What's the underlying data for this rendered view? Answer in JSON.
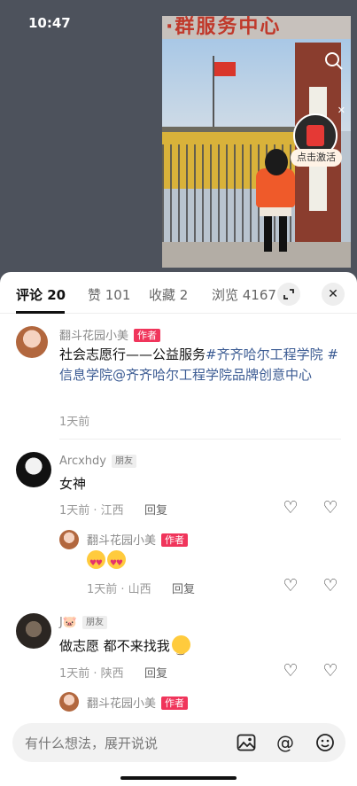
{
  "status": {
    "time": "10:47"
  },
  "video": {
    "banner_text": "·群服务中心",
    "activate_label": "点击激活"
  },
  "tabs": [
    {
      "label": "评论 20"
    },
    {
      "label": "赞 101"
    },
    {
      "label": "收藏 2"
    },
    {
      "label": "浏览 4167"
    }
  ],
  "comments": [
    {
      "user": "翻斗花园小美",
      "badge": "作者",
      "text_plain": "社会志愿行——公益服务",
      "tag1": "#齐齐哈尔工程学院",
      "tag2": "#信息学院",
      "mention": "@齐齐哈尔工程学院品牌创意中心",
      "meta": "1天前"
    },
    {
      "user": "Arcxhdy",
      "badge": "朋友",
      "text": "女神",
      "meta": "1天前 · 江西",
      "reply_label": "回复",
      "reply": {
        "user": "翻斗花园小美",
        "badge": "作者",
        "meta": "1天前 · 山西",
        "reply_label": "回复"
      }
    },
    {
      "user": "J🐷",
      "badge": "朋友",
      "text": "做志愿 都不来找我",
      "meta": "1天前 · 陕西",
      "reply_label": "回复",
      "reply": {
        "user": "翻斗花园小美",
        "badge": "作者"
      }
    }
  ],
  "input": {
    "placeholder": "有什么想法，展开说说"
  },
  "icons": {
    "search": "search-icon",
    "expand": "expand-icon",
    "close": "close-icon",
    "like": "heart-outline-icon",
    "dislike": "broken-heart-icon",
    "image": "image-icon",
    "mention": "at-icon",
    "emoji": "emoji-icon"
  }
}
